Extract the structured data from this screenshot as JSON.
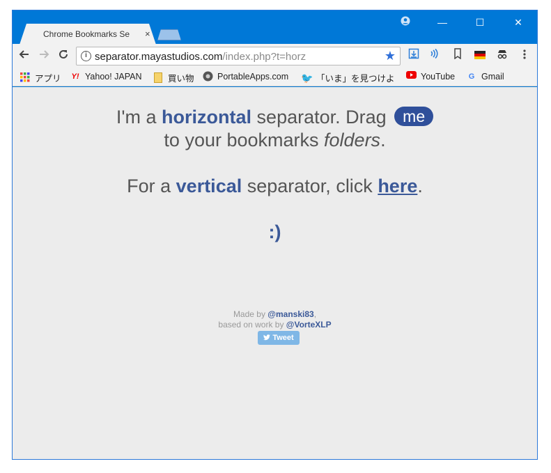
{
  "window": {
    "tab_title": "Chrome Bookmarks Se",
    "tab_close": "×",
    "minimize": "—",
    "maximize": "☐",
    "close": "✕"
  },
  "toolbar": {
    "url_host": "separator.mayastudios.com",
    "url_path": "/index.php?t=horz"
  },
  "bookmarks": [
    {
      "label": "アプリ",
      "icon": "apps-grid-icon"
    },
    {
      "label": "Yahoo! JAPAN",
      "icon": "yahoo-icon"
    },
    {
      "label": "買い物",
      "icon": "folder-icon"
    },
    {
      "label": "PortableApps.com",
      "icon": "portableapps-icon"
    },
    {
      "label": "「いま」を見つけよ",
      "icon": "twitter-icon"
    },
    {
      "label": "YouTube",
      "icon": "youtube-icon"
    },
    {
      "label": "Gmail",
      "icon": "google-icon"
    }
  ],
  "page": {
    "l1_pre": "I'm a ",
    "l1_emph": "horizontal",
    "l1_post": " separator. Drag ",
    "me": "me",
    "l2_pre": "to your bookmarks ",
    "l2_italic": "folders",
    "l2_post": ".",
    "l3_pre": "For a ",
    "l3_emph": "vertical",
    "l3_mid": " separator, click ",
    "l3_link": "here",
    "l3_post": ".",
    "smile": ":)",
    "made_by": "Made by ",
    "made_by_who": "@manski83",
    "made_by_comma": ",",
    "based_on": "based on work by ",
    "based_on_who": "@VorteXLP",
    "tweet": "Tweet"
  },
  "colors": {
    "titlebar": "#0078d7",
    "accent": "#3b5998",
    "pill": "#2f4f9a",
    "tweet": "#7fb7e6",
    "content_bg": "#ececec"
  }
}
